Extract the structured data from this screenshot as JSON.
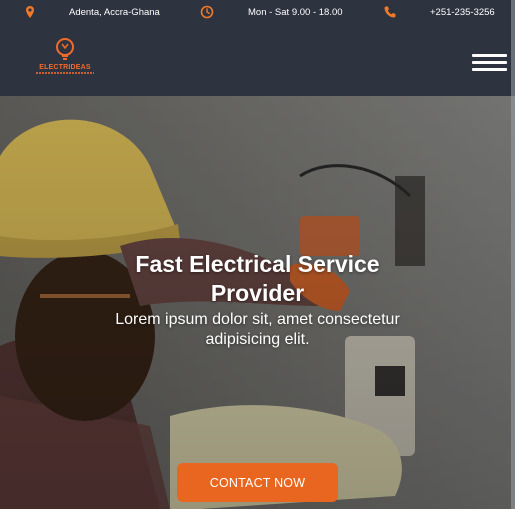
{
  "topbar": {
    "location": "Adenta, Accra-Ghana",
    "hours": "Mon - Sat 9.00 - 18.00",
    "phone": "+251-235-3256"
  },
  "brand": {
    "name": "ELECTRIDEAS"
  },
  "hero": {
    "title": "Fast Electrical Service Provider",
    "subtitle": "Lorem ipsum dolor sit, amet consectetur adipisicing elit.",
    "cta_label": "CONTACT NOW"
  },
  "colors": {
    "header_bg": "#2e3340",
    "accent": "#e8661f",
    "icon_orange": "#f07a2a"
  },
  "icons": {
    "location": "map-pin-icon",
    "hours": "clock-icon",
    "phone": "phone-icon",
    "menu": "hamburger-menu-icon",
    "logo": "lightbulb-logo-icon"
  }
}
